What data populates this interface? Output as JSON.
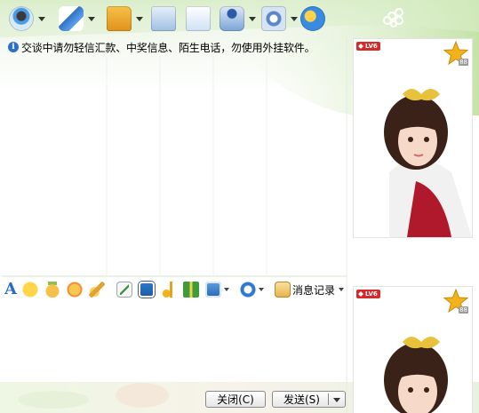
{
  "toolbar": {
    "items": [
      {
        "icon": "webcam-icon",
        "has_dropdown": true
      },
      {
        "icon": "microphone-icon",
        "has_dropdown": true
      },
      {
        "icon": "send-file-icon",
        "has_dropdown": true
      },
      {
        "icon": "mail-icon",
        "has_dropdown": false
      },
      {
        "icon": "add-contact-icon",
        "has_dropdown": false
      },
      {
        "icon": "user-info-icon",
        "has_dropdown": true
      },
      {
        "icon": "app-settings-icon",
        "has_dropdown": true
      },
      {
        "icon": "remote-assist-icon",
        "has_dropdown": false
      }
    ]
  },
  "warning": {
    "icon": "info-icon",
    "text": "交谈中请勿轻信汇款、中奖信息、陌生电话，勿使用外挂软件。"
  },
  "input_toolbar": {
    "font_glyph": "A",
    "items": [
      "font-icon",
      "emoticon-icon",
      "magic-emoticon-icon",
      "shake-window-icon",
      "scribble-icon",
      "edit-image-icon",
      "screen-capture-icon",
      "music-icon",
      "gift-icon",
      "send-picture-icon",
      "soso-icon"
    ],
    "history_label": "消息记录"
  },
  "buttons": {
    "close_label": "关闭(C)",
    "send_label": "发送(S)"
  },
  "profile": {
    "level_badge": "LV6",
    "star_number": "88"
  },
  "colors": {
    "accent_green": "#7cb85a",
    "brand_blue": "#2a6bc5",
    "level_red": "#d52a2a",
    "star_gold": "#f2b21c"
  }
}
